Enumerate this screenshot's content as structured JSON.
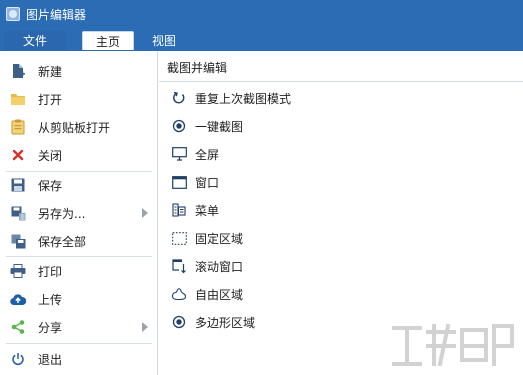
{
  "window": {
    "title": "图片编辑器"
  },
  "tabs": {
    "file": "文件",
    "home": "主页",
    "view": "视图"
  },
  "menu": {
    "items": [
      {
        "label": "新建",
        "icon": "new-file-icon"
      },
      {
        "label": "打开",
        "icon": "folder-icon"
      },
      {
        "label": "从剪贴板打开",
        "icon": "clipboard-icon"
      },
      {
        "label": "关闭",
        "icon": "close-icon"
      },
      {
        "label": "保存",
        "icon": "save-icon"
      },
      {
        "label": "另存为...",
        "icon": "save-as-icon"
      },
      {
        "label": "保存全部",
        "icon": "save-all-icon"
      },
      {
        "label": "打印",
        "icon": "print-icon"
      },
      {
        "label": "上传",
        "icon": "cloud-upload-icon"
      },
      {
        "label": "分享",
        "icon": "share-icon"
      },
      {
        "label": "退出",
        "icon": "power-icon"
      }
    ]
  },
  "panel": {
    "title": "截图并编辑",
    "options": [
      {
        "label": "重复上次截图模式",
        "icon": "repeat-icon"
      },
      {
        "label": "一键截图",
        "icon": "radio-target-icon"
      },
      {
        "label": "全屏",
        "icon": "monitor-icon"
      },
      {
        "label": "窗口",
        "icon": "window-icon"
      },
      {
        "label": "菜单",
        "icon": "menu-icon"
      },
      {
        "label": "固定区域",
        "icon": "dashed-rect-icon"
      },
      {
        "label": "滚动窗口",
        "icon": "scroll-window-icon"
      },
      {
        "label": "自由区域",
        "icon": "freeform-icon"
      },
      {
        "label": "多边形区域",
        "icon": "radio-target-icon"
      }
    ]
  },
  "colors": {
    "titlebar": "#2b6cb5",
    "accent_red": "#d9302c",
    "accent_green": "#5ab34c",
    "icon_blue": "#1f5fa8"
  }
}
